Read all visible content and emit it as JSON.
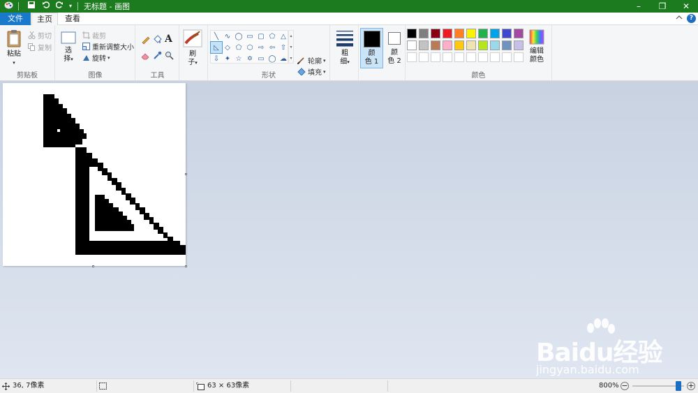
{
  "window": {
    "title": "无标题 - 画图",
    "accent_color": "#1c7a1f",
    "controls": {
      "minimize": "–",
      "restore": "❐",
      "close": "✕"
    }
  },
  "tabs": {
    "file": "文件",
    "home": "主页",
    "view": "查看"
  },
  "help_label": "?",
  "ribbon": {
    "clipboard": {
      "label": "剪贴板",
      "paste": "粘贴",
      "cut": "剪切",
      "copy": "复制"
    },
    "image": {
      "label": "图像",
      "select_line1": "选",
      "select_line2": "择",
      "crop": "裁剪",
      "resize": "重新调整大小",
      "rotate": "旋转"
    },
    "tools": {
      "label": "工具"
    },
    "brush": {
      "line1": "刷",
      "line2": "子"
    },
    "shapes": {
      "label": "形状",
      "outline": "轮廓",
      "fill": "填充"
    },
    "size": {
      "line1": "粗",
      "line2": "细"
    },
    "color1": {
      "line1": "颜",
      "line2": "色 1",
      "value": "#000000"
    },
    "color2": {
      "line1": "颜",
      "line2": "色 2",
      "value": "#ffffff"
    },
    "colors": {
      "label": "颜色",
      "edit_line1": "编辑",
      "edit_line2": "颜色",
      "row1": [
        "#000000",
        "#7f7f7f",
        "#880015",
        "#ed1c24",
        "#ff7f27",
        "#fff200",
        "#22b14c",
        "#00a2e8",
        "#3f48cc",
        "#a349a4"
      ],
      "row2": [
        "#ffffff",
        "#c3c3c3",
        "#b97a57",
        "#ffaec9",
        "#ffc90e",
        "#efe4b0",
        "#b5e61d",
        "#99d9ea",
        "#7092be",
        "#c8bfe7"
      ]
    },
    "font_icon_letter": "A"
  },
  "canvas": {
    "background": "#ffffff",
    "ink": "#000000"
  },
  "watermark": {
    "brand": "Baidu经验",
    "url": "jingyan.baidu.com"
  },
  "status": {
    "cursor_position": "36, 7像素",
    "image_size": "63 × 63像素",
    "zoom": "800%",
    "zoom_slider_fraction": 1.0,
    "zoom_out": "−",
    "zoom_in": "+"
  }
}
